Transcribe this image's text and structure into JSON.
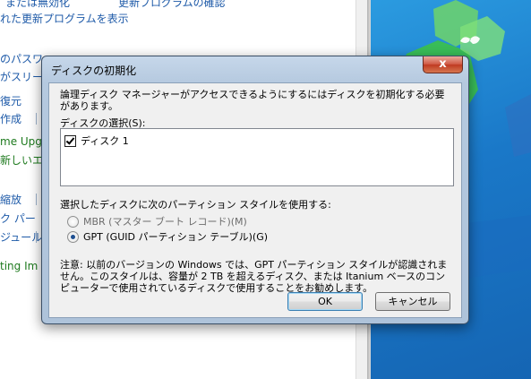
{
  "background_window": {
    "links": [
      "れた更新プログラムを表示",
      "のパスワー",
      "がスリー",
      "復元",
      "作成",
      "me Upgr",
      "新しいエ",
      "縮放",
      "ク パー",
      "ジュール",
      "ting Im"
    ],
    "top_partial_left": "または無効化",
    "top_partial_right": "更新プログラムの確認"
  },
  "dialog": {
    "title": "ディスクの初期化",
    "close_glyph": "x",
    "intro": "論理ディスク マネージャーがアクセスできるようにするにはディスクを初期化する必要があります。",
    "disk_select_label": "ディスクの選択(S):",
    "disks": [
      {
        "label": "ディスク 1",
        "checked": true
      }
    ],
    "partition_style_label": "選択したディスクに次のパーティション スタイルを使用する:",
    "options": [
      {
        "label": "MBR (マスター ブート レコード)(M)",
        "selected": false
      },
      {
        "label": "GPT (GUID パーティション テーブル)(G)",
        "selected": true
      }
    ],
    "note": "注意: 以前のバージョンの Windows では、GPT パーティション スタイルが認識されません。このスタイルは、容量が 2 TB を超えるディスク、または Itanium ベースのコンピューターで使用されているディスクで使用することをお勧めします。",
    "ok_label": "OK",
    "cancel_label": "キャンセル"
  },
  "colors": {
    "link_blue": "#1e5aa8",
    "link_green": "#1e7a1e",
    "desktop_blue": "#1a78c8",
    "close_red": "#c9472f"
  }
}
